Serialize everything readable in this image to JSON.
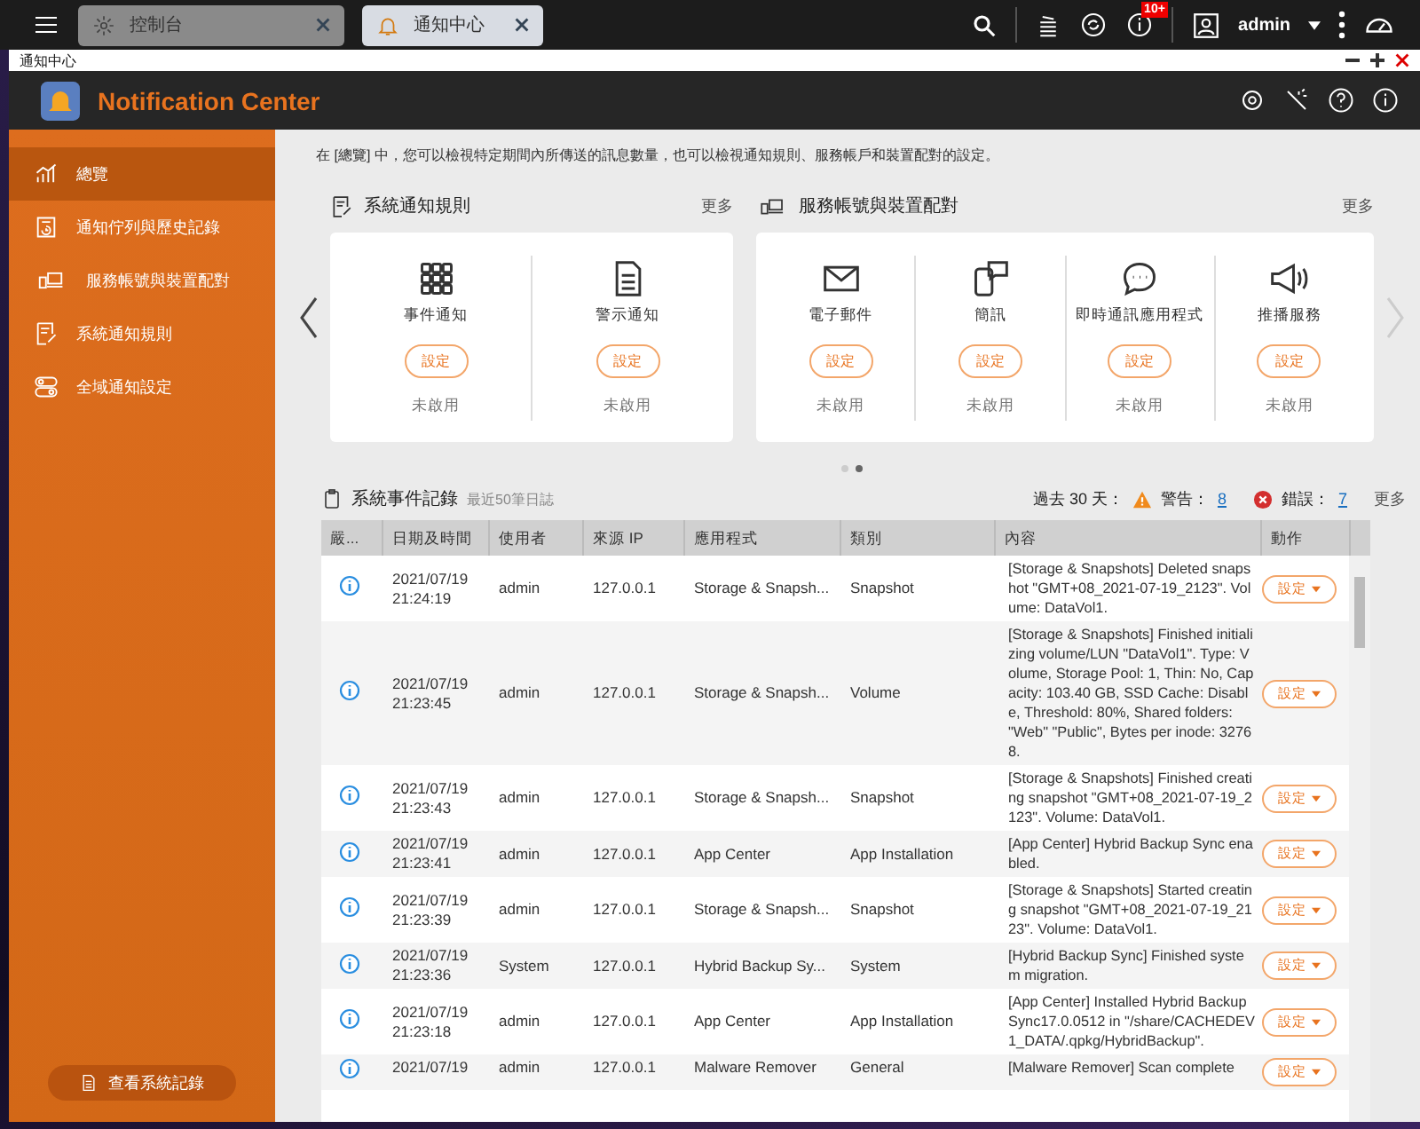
{
  "taskbar": {
    "tabs": [
      {
        "label": "控制台",
        "selected": false
      },
      {
        "label": "通知中心",
        "selected": true
      }
    ],
    "notification_badge": "10+",
    "user": "admin"
  },
  "window": {
    "title": "通知中心"
  },
  "app": {
    "title": "Notification Center"
  },
  "sidebar": {
    "items": [
      {
        "label": "總覽",
        "selected": true
      },
      {
        "label": "通知佇列與歷史記錄",
        "selected": false
      },
      {
        "label": "服務帳號與裝置配對",
        "selected": false
      },
      {
        "label": "系統通知規則",
        "selected": false
      },
      {
        "label": "全域通知設定",
        "selected": false
      }
    ],
    "button": "查看系統記錄"
  },
  "intro": "在 [總覽] 中，您可以檢視特定期間內所傳送的訊息數量，也可以檢視通知規則、服務帳戶和裝置配對的設定。",
  "panels": [
    {
      "title": "系統通知規則",
      "more": "更多",
      "items": [
        {
          "label": "事件通知",
          "button": "設定",
          "status": "未啟用"
        },
        {
          "label": "警示通知",
          "button": "設定",
          "status": "未啟用"
        }
      ]
    },
    {
      "title": "服務帳號與裝置配對",
      "more": "更多",
      "items": [
        {
          "label": "電子郵件",
          "button": "設定",
          "status": "未啟用"
        },
        {
          "label": "簡訊",
          "button": "設定",
          "status": "未啟用"
        },
        {
          "label": "即時通訊應用程式",
          "button": "設定",
          "status": "未啟用"
        },
        {
          "label": "推播服務",
          "button": "設定",
          "status": "未啟用"
        }
      ]
    }
  ],
  "carousel_pages": [
    {
      "selected": false
    },
    {
      "selected": true
    }
  ],
  "event_log": {
    "title": "系統事件記錄",
    "subtitle": "最近50筆日誌",
    "period": "過去 30 天：",
    "warning_label": "警告：",
    "warning_count": "8",
    "error_label": "錯誤：",
    "error_count": "7",
    "more": "更多",
    "columns": [
      "嚴...",
      "日期及時間",
      "使用者",
      "來源 IP",
      "應用程式",
      "類別",
      "內容",
      "動作"
    ],
    "rows": [
      {
        "kind": "info",
        "date": "2021/07/19",
        "time": "21:24:19",
        "user": "admin",
        "ip": "127.0.0.1",
        "app": "Storage & Snapsh...",
        "category": "Snapshot",
        "content": "[Storage & Snapshots] Deleted snapshot \"GMT+08_2021-07-19_2123\". Volume: DataVol1.",
        "action": "設定"
      },
      {
        "kind": "info",
        "date": "2021/07/19",
        "time": "21:23:45",
        "user": "admin",
        "ip": "127.0.0.1",
        "app": "Storage & Snapsh...",
        "category": "Volume",
        "content": "[Storage & Snapshots] Finished initializing volume/LUN \"DataVol1\". Type: Volume, Storage Pool: 1, Thin: No, Capacity: 103.40 GB, SSD Cache: Disable, Threshold: 80%, Shared folders: \"Web\" \"Public\", Bytes per inode: 32768.",
        "action": "設定"
      },
      {
        "kind": "info",
        "date": "2021/07/19",
        "time": "21:23:43",
        "user": "admin",
        "ip": "127.0.0.1",
        "app": "Storage & Snapsh...",
        "category": "Snapshot",
        "content": "[Storage & Snapshots] Finished creating snapshot \"GMT+08_2021-07-19_2123\". Volume: DataVol1.",
        "action": "設定"
      },
      {
        "kind": "info",
        "date": "2021/07/19",
        "time": "21:23:41",
        "user": "admin",
        "ip": "127.0.0.1",
        "app": "App Center",
        "category": "App Installation",
        "content": "[App Center] Hybrid Backup Sync enabled.",
        "action": "設定"
      },
      {
        "kind": "info",
        "date": "2021/07/19",
        "time": "21:23:39",
        "user": "admin",
        "ip": "127.0.0.1",
        "app": "Storage & Snapsh...",
        "category": "Snapshot",
        "content": "[Storage & Snapshots] Started creating snapshot \"GMT+08_2021-07-19_2123\". Volume: DataVol1.",
        "action": "設定"
      },
      {
        "kind": "info",
        "date": "2021/07/19",
        "time": "21:23:36",
        "user": "System",
        "ip": "127.0.0.1",
        "app": "Hybrid Backup Sy...",
        "category": "System",
        "content": "[Hybrid Backup Sync] Finished system migration.",
        "action": "設定"
      },
      {
        "kind": "info",
        "date": "2021/07/19",
        "time": "21:23:18",
        "user": "admin",
        "ip": "127.0.0.1",
        "app": "App Center",
        "category": "App Installation",
        "content": "[App Center] Installed Hybrid Backup Sync17.0.0512 in \"/share/CACHEDEV1_DATA/.qpkg/HybridBackup\".",
        "action": "設定"
      },
      {
        "kind": "info",
        "date": "2021/07/19",
        "user": "admin",
        "ip": "127.0.0.1",
        "app": "Malware Remover",
        "category": "General",
        "content": "[Malware Remover] Scan complete",
        "action": "設定"
      }
    ]
  }
}
